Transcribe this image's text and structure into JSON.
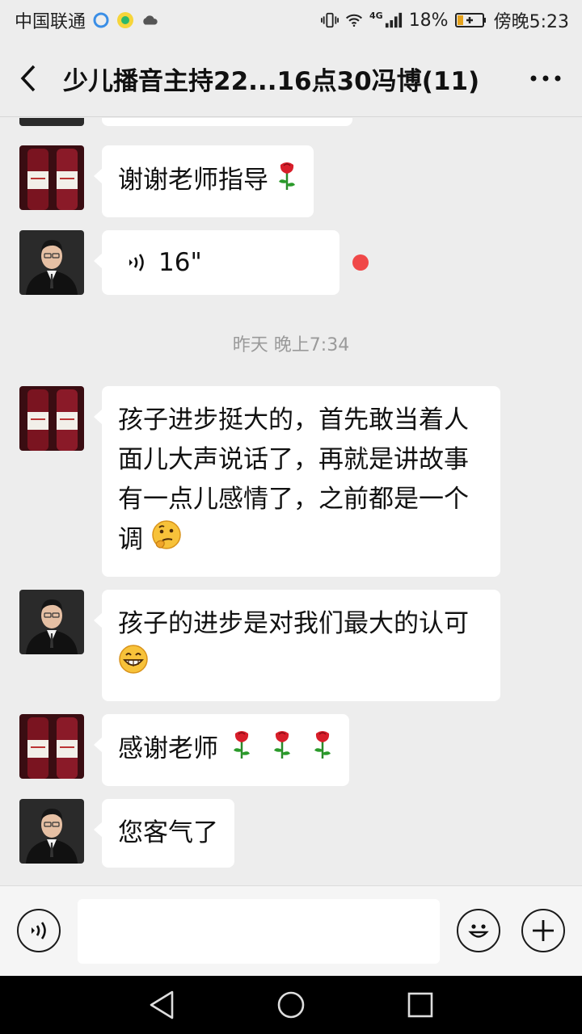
{
  "status_bar": {
    "carrier": "中国联通",
    "network": "4G",
    "battery": "18%",
    "time": "傍晚5:23"
  },
  "header": {
    "title": "少儿播音主持22...16点30冯博(11)"
  },
  "messages": {
    "m1": {
      "text": "谢谢老师指导"
    },
    "m2": {
      "duration": "16\""
    },
    "timestamp": "昨天 晚上7:34",
    "m3": {
      "text": "孩子进步挺大的，首先敢当着人面儿大声说话了，再就是讲故事有一点儿感情了，之前都是一个调"
    },
    "m4": {
      "text": "孩子的进步是对我们最大的认可"
    },
    "m5": {
      "text": "感谢老师"
    },
    "m6": {
      "text": "您客气了"
    }
  },
  "input_bar": {
    "message_value": ""
  },
  "icons": {
    "rose": "rose-icon",
    "thinking": "thinking-face-icon",
    "grin": "grin-face-icon"
  },
  "colors": {
    "background": "#ededed",
    "bubble": "#ffffff",
    "unread_dot": "#f04848",
    "navbar": "#000000"
  }
}
